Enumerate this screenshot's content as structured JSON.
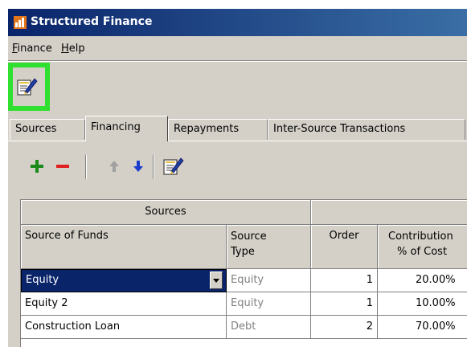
{
  "window": {
    "title": "Structured Finance"
  },
  "menu": {
    "finance_label": "Finance",
    "finance_mnemonic": "F",
    "finance_rest": "inance",
    "help_label": "Help",
    "help_mnemonic": "H",
    "help_rest": "elp"
  },
  "tabs": [
    {
      "label": "Sources"
    },
    {
      "label": "Financing"
    },
    {
      "label": "Repayments"
    },
    {
      "label": "Inter-Source Transactions"
    }
  ],
  "active_tab": "Financing",
  "actions": {
    "add_icon": "plus-icon",
    "remove_icon": "minus-icon",
    "move_up_icon": "arrow-up-icon",
    "move_down_icon": "arrow-down-icon",
    "edit_icon": "edit-document-icon"
  },
  "grid": {
    "group_header": "Sources",
    "columns": {
      "source_of_funds": "Source of Funds",
      "source_type_line1": "Source",
      "source_type_line2": "Type",
      "order": "Order",
      "contribution_line1": "Contribution",
      "contribution_line2": "% of Cost"
    },
    "rows": [
      {
        "source": "Equity",
        "type": "Equity",
        "order": "1",
        "contribution": "20.00%"
      },
      {
        "source": "Equity 2",
        "type": "Equity",
        "order": "1",
        "contribution": "10.00%"
      },
      {
        "source": "Construction Loan",
        "type": "Debt",
        "order": "2",
        "contribution": "70.00%"
      }
    ]
  },
  "colors": {
    "title_bar": "#0a246a",
    "selection": "#0a246a",
    "highlight": "#30e030",
    "add_green": "#1a8a1a",
    "remove_red": "#e02020",
    "down_blue": "#1a3ccc"
  }
}
